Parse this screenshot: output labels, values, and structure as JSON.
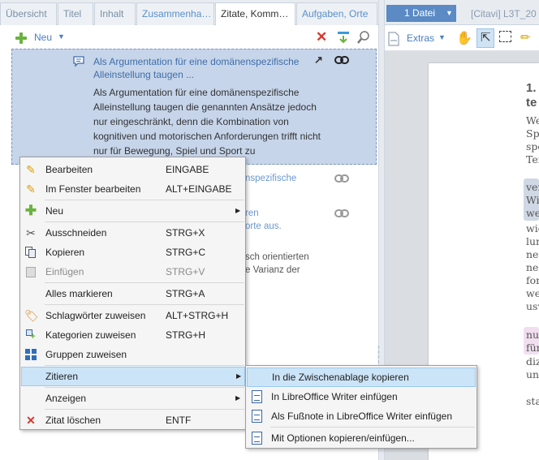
{
  "tabs": [
    {
      "label": "Übersicht",
      "state": "inactive"
    },
    {
      "label": "Titel",
      "state": "inactive"
    },
    {
      "label": "Inhalt",
      "state": "inactive"
    },
    {
      "label": "Zusammenha…",
      "state": "inactive-blue"
    },
    {
      "label": "Zitate, Komm…",
      "state": "active"
    },
    {
      "label": "Aufgaben, Orte",
      "state": "inactive-blue"
    }
  ],
  "toolbar": {
    "new_label": "Neu"
  },
  "quote": {
    "title": "Als Argumentation für eine domänenspezifische Alleinstellung taugen ...",
    "body": "Als Argumentation für eine domänenspezifische Alleinstellung taugen die genannten Ansätze jedoch nur eingeschränkt, denn die Kombination von kognitiven und motorischen Anforderungen trifft nicht nur für Bewegung, Spiel und Sport zu"
  },
  "list_fragments": {
    "f1": "nspezifische",
    "f2": "ren",
    "f3": "orte aus.",
    "f4": "sch orientierten",
    "f5": "e Varianz der"
  },
  "right_panel": {
    "file_button": "1 Datei",
    "window_title": "[Citavi]  L3T_20",
    "extras_label": "Extras",
    "doc_lines": [
      "1.",
      "te",
      "We",
      "Sp",
      "spo",
      "Tei",
      "ver",
      "Wi",
      "we",
      "wie",
      "lum",
      "ner",
      "nel",
      "for",
      "we",
      "usv",
      "nur",
      "für",
      "diz",
      "und",
      "sta"
    ]
  },
  "context_menu": {
    "items": [
      {
        "icon": "pencil-icon",
        "label": "Bearbeiten",
        "shortcut": "EINGABE",
        "state": "normal"
      },
      {
        "icon": "pencil-icon",
        "label": "Im Fenster bearbeiten",
        "shortcut": "ALT+EINGABE",
        "state": "normal"
      },
      {
        "icon": "plus-icon",
        "label": "Neu",
        "shortcut": "",
        "state": "submenu"
      },
      {
        "icon": "scissors-icon",
        "label": "Ausschneiden",
        "shortcut": "STRG+X",
        "state": "normal"
      },
      {
        "icon": "copy-icon",
        "label": "Kopieren",
        "shortcut": "STRG+C",
        "state": "normal"
      },
      {
        "icon": "paste-icon",
        "label": "Einfügen",
        "shortcut": "STRG+V",
        "state": "disabled"
      },
      {
        "icon": "",
        "label": "Alles markieren",
        "shortcut": "STRG+A",
        "state": "normal"
      },
      {
        "icon": "tag-icon",
        "label": "Schlagwörter zuweisen",
        "shortcut": "ALT+STRG+H",
        "state": "normal"
      },
      {
        "icon": "category-icon",
        "label": "Kategorien zuweisen",
        "shortcut": "STRG+H",
        "state": "normal"
      },
      {
        "icon": "groups-icon",
        "label": "Gruppen zuweisen",
        "shortcut": "",
        "state": "normal"
      },
      {
        "icon": "",
        "label": "Zitieren",
        "shortcut": "",
        "state": "selected-submenu"
      },
      {
        "icon": "",
        "label": "Anzeigen",
        "shortcut": "",
        "state": "submenu"
      },
      {
        "icon": "delete-icon",
        "label": "Zitat löschen",
        "shortcut": "ENTF",
        "state": "normal"
      }
    ]
  },
  "submenu": {
    "items": [
      {
        "label": "In die Zwischenablage kopieren",
        "state": "selected"
      },
      {
        "label": "In LibreOffice Writer einfügen",
        "state": "normal"
      },
      {
        "label": "Als Fußnote in LibreOffice Writer einfügen",
        "state": "normal"
      },
      {
        "label": "Mit Optionen kopieren/einfügen...",
        "state": "normal"
      }
    ]
  },
  "colors": {
    "accent": "#5b8ac4",
    "selection": "#cce4f7",
    "card": "#c6d5ea",
    "delete": "#d9362b",
    "add": "#69b33c"
  }
}
